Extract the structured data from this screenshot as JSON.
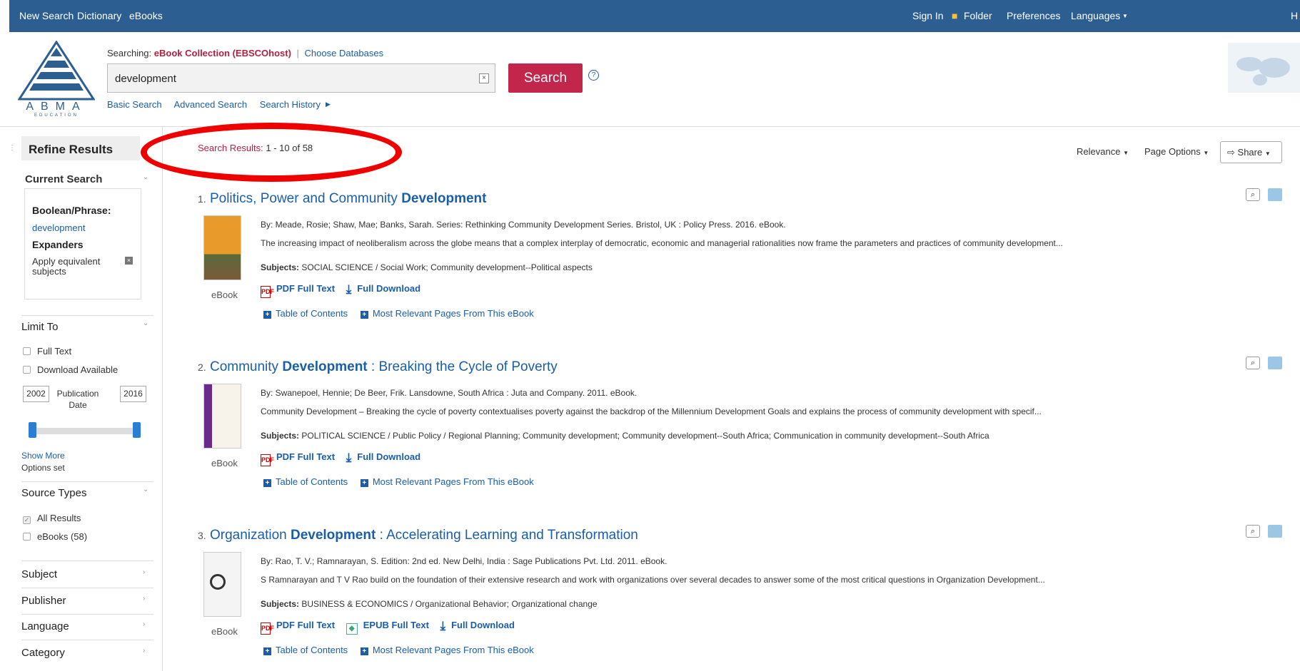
{
  "topnav": {
    "left": [
      "New Search",
      "Dictionary",
      "eBooks"
    ],
    "right": {
      "sign_in": "Sign In",
      "folder": "Folder",
      "preferences": "Preferences",
      "languages": "Languages",
      "h": "H"
    }
  },
  "logo": {
    "text": "ABMA",
    "sub": "EDUCATION"
  },
  "search": {
    "searching_label": "Searching:",
    "database": "eBook Collection (EBSCOhost)",
    "choose_db": "Choose Databases",
    "query": "development",
    "button": "Search",
    "basic": "Basic Search",
    "advanced": "Advanced Search",
    "history": "Search History"
  },
  "sidebar": {
    "refine": "Refine Results",
    "current_search": "Current Search",
    "boolean_label": "Boolean/Phrase:",
    "boolean_value": "development",
    "expanders": "Expanders",
    "expander_item": "Apply equivalent subjects",
    "limit_to": "Limit To",
    "full_text": "Full Text",
    "download_available": "Download Available",
    "year_from": "2002",
    "year_to": "2016",
    "pub_date": "Publication Date",
    "show_more": "Show More",
    "options_set": "Options set",
    "source_types": "Source Types",
    "all_results": "All Results",
    "ebooks": "eBooks (58)",
    "subject": "Subject",
    "publisher": "Publisher",
    "language": "Language",
    "category": "Category"
  },
  "results_header": {
    "label": "Search Results:",
    "range": "1 - 10 of 58",
    "relevance": "Relevance",
    "page_options": "Page Options",
    "share": "Share"
  },
  "results": [
    {
      "num": "1.",
      "title_pre": "Politics, Power and Community ",
      "title_bold": "Development",
      "title_post": "",
      "byline": "By: Meade, Rosie; Shaw, Mae; Banks, Sarah. Series: Rethinking Community Development Series. Bristol, UK : Policy Press. 2016. eBook.",
      "abstract": "The increasing impact of neoliberalism across the globe means that a complex interplay of democratic, economic and managerial rationalities now frame the parameters and practices of community development...",
      "subjects_label": "Subjects:",
      "subjects": "SOCIAL SCIENCE / Social Work; Community development--Political aspects",
      "type": "eBook",
      "pdf": "PDF Full Text",
      "download": "Full Download",
      "toc": "Table of Contents",
      "relevant": "Most Relevant Pages From This eBook"
    },
    {
      "num": "2.",
      "title_pre": "Community ",
      "title_bold": "Development",
      "title_post": " : Breaking the Cycle of Poverty",
      "byline": "By: Swanepoel, Hennie; De Beer, Frik. Lansdowne, South Africa : Juta and Company. 2011. eBook.",
      "abstract": "Community Development – Breaking the cycle of poverty contextualises poverty against the backdrop of the Millennium Development Goals and explains the process of community development with specif...",
      "subjects_label": "Subjects:",
      "subjects": "POLITICAL SCIENCE / Public Policy / Regional Planning; Community development; Community development--South Africa; Communication in community development--South Africa",
      "type": "eBook",
      "pdf": "PDF Full Text",
      "download": "Full Download",
      "toc": "Table of Contents",
      "relevant": "Most Relevant Pages From This eBook"
    },
    {
      "num": "3.",
      "title_pre": "Organization ",
      "title_bold": "Development",
      "title_post": " : Accelerating Learning and Transformation",
      "byline": "By: Rao, T. V.; Ramnarayan, S. Edition: 2nd ed. New Delhi, India : Sage Publications Pvt. Ltd. 2011. eBook.",
      "abstract": "S Ramnarayan and T V Rao build on the foundation of their extensive research and work with organizations over several decades to answer some of the most critical questions in Organization Development...",
      "subjects_label": "Subjects:",
      "subjects": "BUSINESS & ECONOMICS / Organizational Behavior; Organizational change",
      "type": "eBook",
      "pdf": "PDF Full Text",
      "epub": "EPUB Full Text",
      "download": "Full Download",
      "toc": "Table of Contents",
      "relevant": "Most Relevant Pages From This eBook"
    }
  ]
}
